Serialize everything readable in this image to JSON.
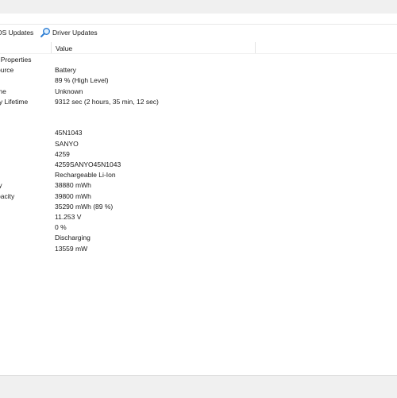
{
  "toolbar": {
    "bios_label": "OS Updates",
    "driver_label": "Driver Updates",
    "driver_icon": "search-icon"
  },
  "columns": {
    "field": "",
    "value": "Value"
  },
  "rows": [
    {
      "field": "t Properties",
      "value": ""
    },
    {
      "field": "ource",
      "value": "Battery"
    },
    {
      "field": "",
      "value": "89 % (High Level)"
    },
    {
      "field": "me",
      "value": "Unknown"
    },
    {
      "field": "ry Lifetime",
      "value": "9312 sec (2 hours, 35 min, 12 sec)"
    },
    {
      "field": "",
      "value": ""
    },
    {
      "field": "",
      "value": ""
    },
    {
      "field": "",
      "value": "45N1043"
    },
    {
      "field": "",
      "value": "SANYO"
    },
    {
      "field": "",
      "value": "4259"
    },
    {
      "field": "",
      "value": "4259SANYO45N1043"
    },
    {
      "field": "",
      "value": "Rechargeable Li-Ion"
    },
    {
      "field": "ty",
      "value": "38880 mWh"
    },
    {
      "field": "pacity",
      "value": "39800 mWh"
    },
    {
      "field": "",
      "value": "35290 mWh  (89 %)"
    },
    {
      "field": "",
      "value": "11.253 V"
    },
    {
      "field": "",
      "value": "0 %"
    },
    {
      "field": "",
      "value": "Discharging"
    },
    {
      "field": "",
      "value": "13559 mW"
    }
  ]
}
